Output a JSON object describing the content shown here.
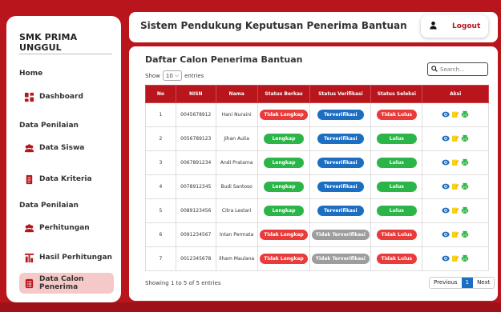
{
  "sidebar": {
    "brand": "SMK PRIMA UNGGUL",
    "section_home": "Home",
    "section_penilaian_1": "Data Penilaian",
    "section_penilaian_2": "Data Penilaian",
    "items": [
      {
        "label": "Dashboard",
        "icon": "dashboard-icon"
      },
      {
        "label": "Data Siswa",
        "icon": "users-icon"
      },
      {
        "label": "Data Kriteria",
        "icon": "document-icon"
      },
      {
        "label": "Perhitungan",
        "icon": "users-icon"
      },
      {
        "label": "Hasil Perhitungan",
        "icon": "chart-icon"
      },
      {
        "label": "Data Calon Penerima",
        "icon": "list-icon",
        "active": true
      }
    ]
  },
  "header": {
    "title": "Sistem Pendukung Keputusan Penerima Bantuan",
    "logout_label": "Logout"
  },
  "panel": {
    "title": "Daftar Calon Penerima Bantuan",
    "show_label": "Show",
    "show_value": "10",
    "entries_label": "entries",
    "search_placeholder": "Search...",
    "columns": [
      "No",
      "NISN",
      "Nama",
      "Status Berkas",
      "Status Verifikasi",
      "Status Seleksi",
      "Aksi"
    ],
    "rows": [
      {
        "no": "1",
        "nisn": "0045678912",
        "nama": "Hani Nuraini",
        "berkas": "Tidak Lengkap",
        "berkas_color": "red",
        "verifikasi": "Terverifikasi",
        "verifikasi_color": "blue",
        "seleksi": "Tidak Lulus",
        "seleksi_color": "red"
      },
      {
        "no": "2",
        "nisn": "0056789123",
        "nama": "Jihan Aulia",
        "berkas": "Lengkap",
        "berkas_color": "green",
        "verifikasi": "Terverifikasi",
        "verifikasi_color": "blue",
        "seleksi": "Lulus",
        "seleksi_color": "green"
      },
      {
        "no": "3",
        "nisn": "0067891234",
        "nama": "Andi Pratama",
        "berkas": "Lengkap",
        "berkas_color": "green",
        "verifikasi": "Terverifikasi",
        "verifikasi_color": "blue",
        "seleksi": "Lulus",
        "seleksi_color": "green"
      },
      {
        "no": "4",
        "nisn": "0078912345",
        "nama": "Budi Santoso",
        "berkas": "Lengkap",
        "berkas_color": "green",
        "verifikasi": "Terverifikasi",
        "verifikasi_color": "blue",
        "seleksi": "Lulus",
        "seleksi_color": "green"
      },
      {
        "no": "5",
        "nisn": "0089123456",
        "nama": "Citra Lestari",
        "berkas": "Lengkap",
        "berkas_color": "green",
        "verifikasi": "Terverifikasi",
        "verifikasi_color": "blue",
        "seleksi": "Lulus",
        "seleksi_color": "green"
      },
      {
        "no": "6",
        "nisn": "0091234567",
        "nama": "Intan Permata",
        "berkas": "Tidak Lengkap",
        "berkas_color": "red",
        "verifikasi": "Tidak Terverifikasi",
        "verifikasi_color": "gray",
        "seleksi": "Tidak Lulus",
        "seleksi_color": "red"
      },
      {
        "no": "7",
        "nisn": "0012345678",
        "nama": "Ilham Maulana",
        "berkas": "Tidak Lengkap",
        "berkas_color": "red",
        "verifikasi": "Tidak Terverifikasi",
        "verifikasi_color": "gray",
        "seleksi": "Tidak Lulus",
        "seleksi_color": "red"
      }
    ],
    "footer_text": "Showing 1 to 5 of 5 entries",
    "pager": {
      "previous": "Previous",
      "current": "1",
      "next": "Next"
    }
  },
  "colors": {
    "brand_red": "#b8161c",
    "active_nav_bg": "#f6c9c9",
    "pill_red": "#ea3b3b",
    "pill_green": "#2bb548",
    "pill_blue": "#1b6ec2",
    "pill_gray": "#9d9d9d"
  }
}
